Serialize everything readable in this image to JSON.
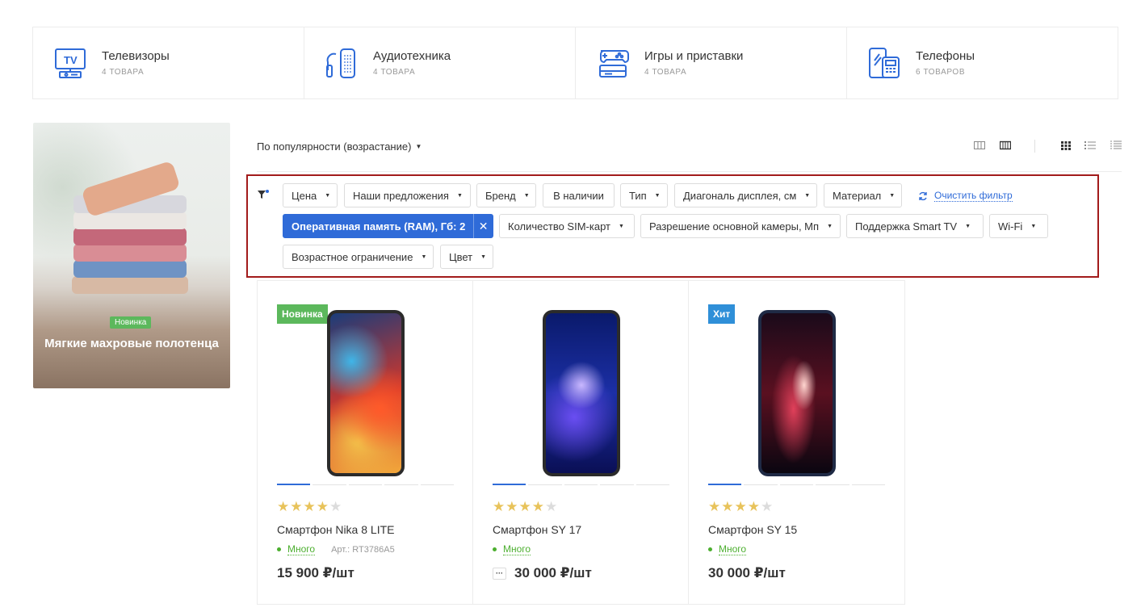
{
  "categories": [
    {
      "title": "Телевизоры",
      "count": "4 товара",
      "icon": "tv-icon"
    },
    {
      "title": "Аудиотехника",
      "count": "4 товара",
      "icon": "speaker-icon"
    },
    {
      "title": "Игры и приставки",
      "count": "4 товара",
      "icon": "gamepad-icon"
    },
    {
      "title": "Телефоны",
      "count": "6 товаров",
      "icon": "phone-icon"
    }
  ],
  "banner": {
    "badge": "Новинка",
    "title": "Мягкие махровые полотенца"
  },
  "sort": {
    "label": "По популярности (возрастание)"
  },
  "filters": {
    "price": "Цена",
    "offers": "Наши предложения",
    "brand": "Бренд",
    "in_stock": "В наличии",
    "type": "Тип",
    "diagonal": "Диагональ дисплея, см",
    "material": "Материал",
    "clear": "Очистить фильтр",
    "ram": "Оперативная память (RAM), Гб: 2",
    "sim": "Количество SIM-карт",
    "camera": "Разрешение основной камеры, Мп",
    "smart_tv": "Поддержка Smart TV",
    "wifi": "Wi-Fi",
    "age": "Возрастное ограничение",
    "color": "Цвет"
  },
  "products": [
    {
      "badge": "Новинка",
      "name": "Смартфон Nika 8 LITE",
      "stock": "Много",
      "sku": "Арт.: RT3786A5",
      "price": "15 900 ₽/шт",
      "rating": 4
    },
    {
      "badge": "",
      "name": "Смартфон SY 17",
      "stock": "Много",
      "sku": "",
      "price": "30 000 ₽/шт",
      "more": "···",
      "rating": 4
    },
    {
      "badge": "Хит",
      "name": "Смартфон SY 15",
      "stock": "Много",
      "sku": "",
      "price": "30 000 ₽/шт",
      "rating": 4
    }
  ],
  "colors": {
    "accent": "#2f6bd8",
    "new_badge": "#5cb85c",
    "hit_badge": "#2f8fd8",
    "stock": "#4caf2f",
    "filter_border": "#a21b1b"
  }
}
